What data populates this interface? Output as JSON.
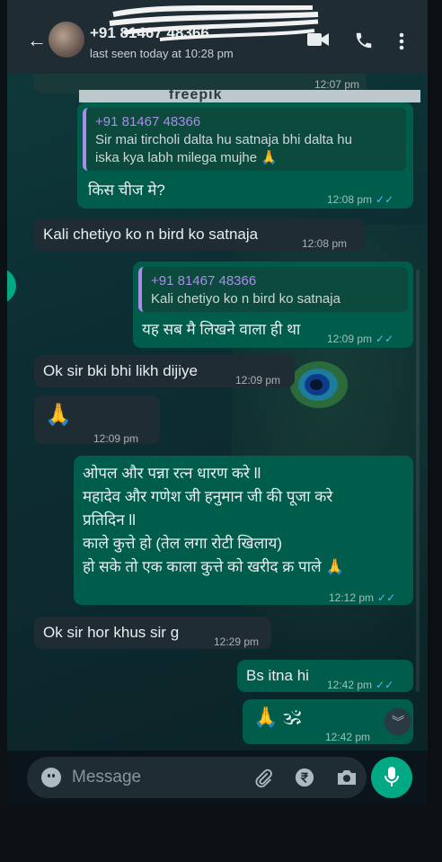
{
  "header": {
    "back_glyph": "←",
    "contact_name": "+91 81467 48366",
    "last_seen": "last seen today at 10:28 pm"
  },
  "watermark": "freepik",
  "messages": [
    {
      "time": "12:07 pm"
    },
    {
      "quote_name": "+91 81467 48366",
      "quote_line1": "Sir mai tircholi dalta hu satnaja bhi dalta hu",
      "quote_line2": "iska kya labh milega mujhe 🙏",
      "text": "किस चीज मे?",
      "time": "12:08 pm"
    },
    {
      "text": "Kali chetiyo ko n bird ko satnaja",
      "time": "12:08 pm"
    },
    {
      "quote_name": "+91 81467 48366",
      "quote_text": "Kali chetiyo ko n bird ko satnaja",
      "text": "यह सब मै लिखने वाला ही था",
      "time": "12:09 pm"
    },
    {
      "text": "Ok sir bki bhi likh dijiye",
      "time": "12:09 pm"
    },
    {
      "text": "🙏",
      "time": "12:09 pm"
    },
    {
      "line1": "ओपल और पन्ना रत्न धारण करे ll",
      "line2": "महादेव और गणेश जी हनुमान जी की पूजा करे",
      "line3": "प्रतिदिन ll",
      "line4": "काले कुत्ते हो (तेल लगा रोटी खिलाय)",
      "line5": "हो सके तो एक काला कुत्ते को खरीद क्र पाले 🙏",
      "time": "12:12 pm"
    },
    {
      "text": "Ok sir hor khus sir g",
      "time": "12:29 pm"
    },
    {
      "text": "Bs itna hi",
      "time": "12:42 pm"
    },
    {
      "text": "🙏 🕉",
      "time": "12:42 pm"
    }
  ],
  "ticks": "✓✓",
  "input": {
    "placeholder": "Message"
  },
  "colors": {
    "incoming": "#1f2c34",
    "outgoing": "#005c4b",
    "accent": "#00a884",
    "read_ticks": "#53bdeb"
  }
}
